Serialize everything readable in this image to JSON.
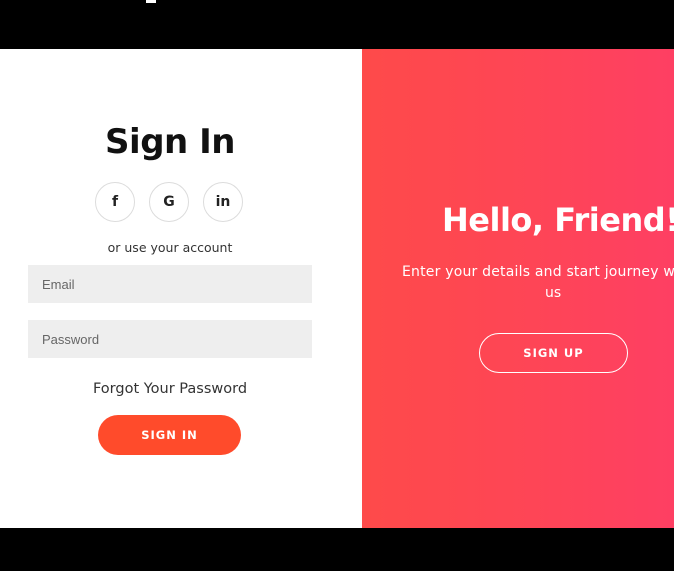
{
  "signin": {
    "title": "Sign In",
    "social": [
      {
        "label": "f"
      },
      {
        "label": "G"
      },
      {
        "label": "in"
      }
    ],
    "or_text": "or use your account",
    "email_placeholder": "Email",
    "password_placeholder": "Password",
    "forgot": "Forgot Your Password",
    "button": "SIGN IN"
  },
  "overlay": {
    "title": "Hello, Friend!",
    "description_line1": "Enter your details and start journey with",
    "description_line2": "us",
    "button": "SIGN UP"
  },
  "colors": {
    "accent": "#ff4b2b",
    "overlay_start": "#fe4a4a",
    "overlay_end": "#fe3f63"
  }
}
